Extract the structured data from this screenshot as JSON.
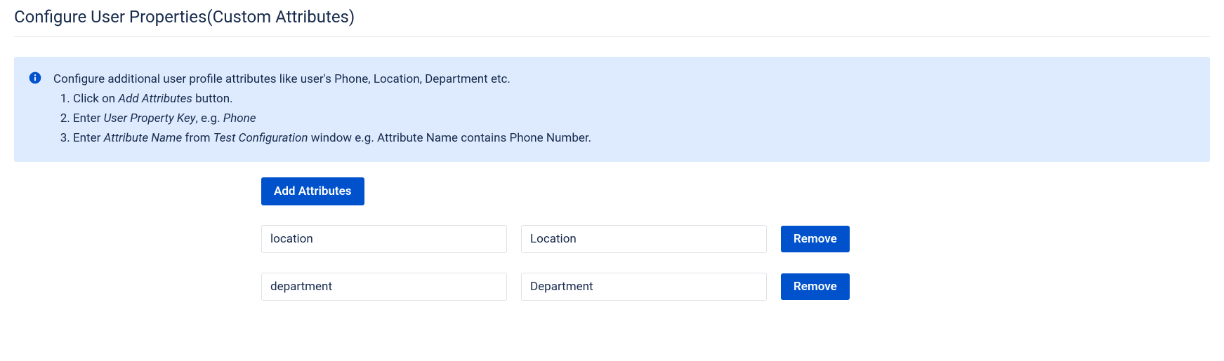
{
  "page": {
    "title": "Configure User Properties(Custom Attributes)"
  },
  "info": {
    "intro": "Configure additional user profile attributes like user's Phone, Location, Department etc.",
    "steps": [
      {
        "prefix": "Click on ",
        "em": "Add Attributes",
        "suffix": " button."
      },
      {
        "prefix": "Enter ",
        "em": "User Property Key",
        "mid": ", e.g. ",
        "em2": "Phone",
        "suffix": ""
      },
      {
        "prefix": "Enter ",
        "em": "Attribute Name",
        "mid": " from ",
        "em2": "Test Configuration",
        "suffix": " window e.g. Attribute Name contains Phone Number."
      }
    ]
  },
  "buttons": {
    "add": "Add Attributes",
    "remove": "Remove"
  },
  "rows": [
    {
      "key": "location",
      "name": "Location"
    },
    {
      "key": "department",
      "name": "Department"
    }
  ]
}
